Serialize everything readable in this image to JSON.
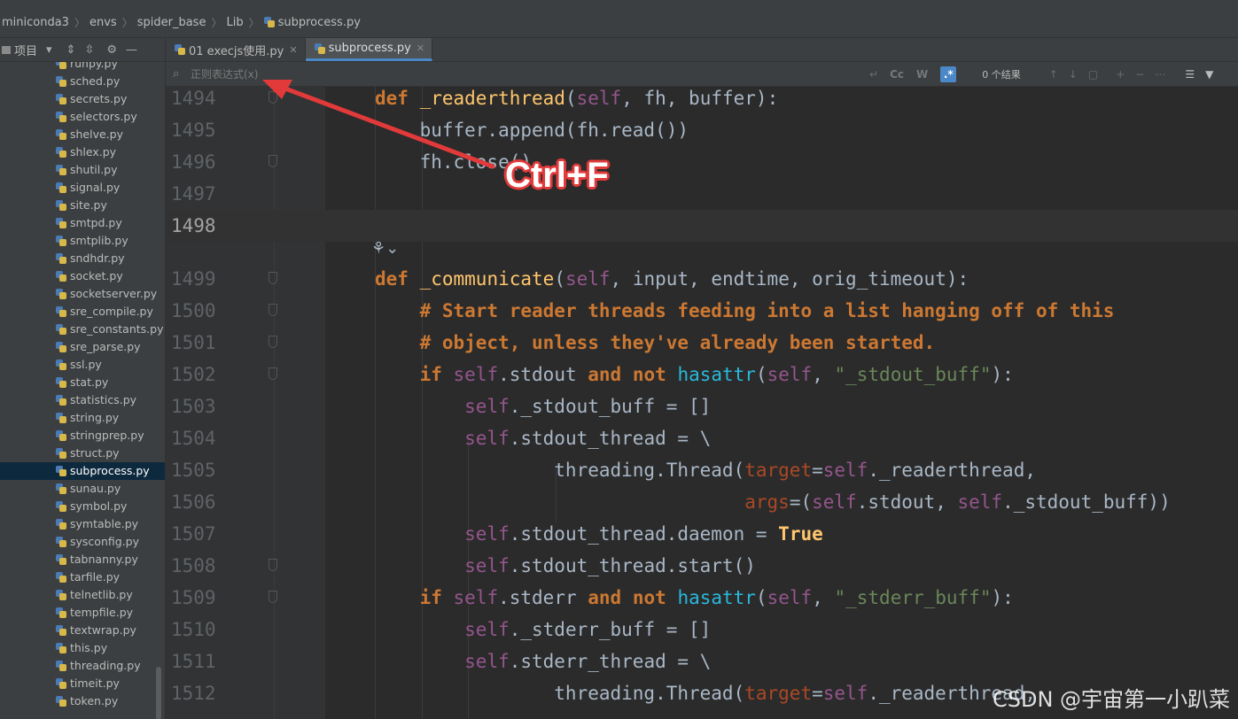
{
  "breadcrumb": [
    "miniconda3",
    "envs",
    "spider_base",
    "Lib",
    "subprocess.py"
  ],
  "sidebar": {
    "title": "项目",
    "files": [
      "runpy.py",
      "sched.py",
      "secrets.py",
      "selectors.py",
      "shelve.py",
      "shlex.py",
      "shutil.py",
      "signal.py",
      "site.py",
      "smtpd.py",
      "smtplib.py",
      "sndhdr.py",
      "socket.py",
      "socketserver.py",
      "sre_compile.py",
      "sre_constants.py",
      "sre_parse.py",
      "ssl.py",
      "stat.py",
      "statistics.py",
      "string.py",
      "stringprep.py",
      "struct.py",
      "subprocess.py",
      "sunau.py",
      "symbol.py",
      "symtable.py",
      "sysconfig.py",
      "tabnanny.py",
      "tarfile.py",
      "telnetlib.py",
      "tempfile.py",
      "textwrap.py",
      "this.py",
      "threading.py",
      "timeit.py",
      "token.py"
    ],
    "selected": "subprocess.py"
  },
  "tabs": [
    {
      "label": "01 execjs使用.py",
      "active": false
    },
    {
      "label": "subprocess.py",
      "active": true
    }
  ],
  "search": {
    "placeholder": "正则表达式(x)",
    "case_label": "Cc",
    "word_label": "W",
    "regex_label": ".*",
    "results": "0 个结果"
  },
  "editor": {
    "line_numbers": [
      "1494",
      "1495",
      "1496",
      "1497",
      "1498",
      "1499",
      "1500",
      "1501",
      "1502",
      "1503",
      "1504",
      "1505",
      "1506",
      "1507",
      "1508",
      "1509",
      "1510",
      "1511",
      "1512"
    ],
    "current_line": "1498"
  },
  "annotation": {
    "label": "Ctrl+F",
    "color": "#e23a3a"
  },
  "watermark": "CSDN @宇宙第一小趴菜"
}
